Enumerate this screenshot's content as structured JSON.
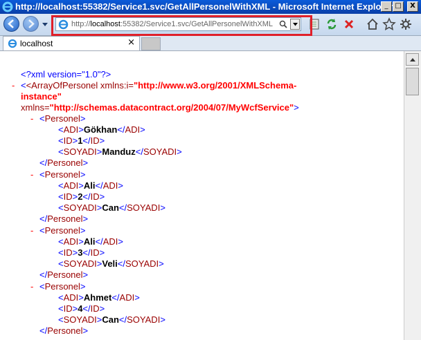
{
  "window": {
    "title": "http://localhost:55382/Service1.svc/GetAllPersonelWithXML - Microsoft Internet Explorer",
    "minimize": "_",
    "maximize": "□",
    "close": "X"
  },
  "address": {
    "prefix": "http://",
    "host": "localhost",
    "rest": ":55382/Service1.svc/GetAllPersonelWithXML"
  },
  "tab": {
    "label": "localhost",
    "close": "×"
  },
  "xml": {
    "decl": "<?xml version=\"1.0\"?>",
    "minus": "-",
    "root_open": "<ArrayOfPersonel xmlns:i=",
    "ns1_a": "\"http://www.w3.org/2001/XMLSchema-",
    "ns1_b": "instance\"",
    "xmlns": "xmlns=",
    "ns2": "\"http://schemas.datacontract.org/2004/07/MyWcfService\"",
    "gt": ">",
    "personel_open": "<Personel>",
    "personel_close": "</Personel>",
    "adi_open": "<ADI>",
    "adi_close": "</ADI>",
    "id_open": "<ID>",
    "id_close": "</ID>",
    "soyadi_open": "<SOYADI>",
    "soyadi_close": "</SOYADI>",
    "records": [
      {
        "adi": "Gökhan",
        "id": "1",
        "soyadi": "Manduz"
      },
      {
        "adi": "Ali",
        "id": "2",
        "soyadi": "Can"
      },
      {
        "adi": "Ali",
        "id": "3",
        "soyadi": "Veli"
      },
      {
        "adi": "Ahmet",
        "id": "4",
        "soyadi": "Can"
      }
    ]
  },
  "icons": [
    "ie-icon",
    "back-icon",
    "forward-icon",
    "search-icon",
    "compatibility-icon",
    "refresh-icon",
    "stop-icon",
    "home-icon",
    "favorites-icon",
    "tools-icon"
  ],
  "colors": {
    "highlight": "#e0202a",
    "tag": "#990000",
    "bracket": "#0000ff",
    "namespace": "#ff0000"
  }
}
